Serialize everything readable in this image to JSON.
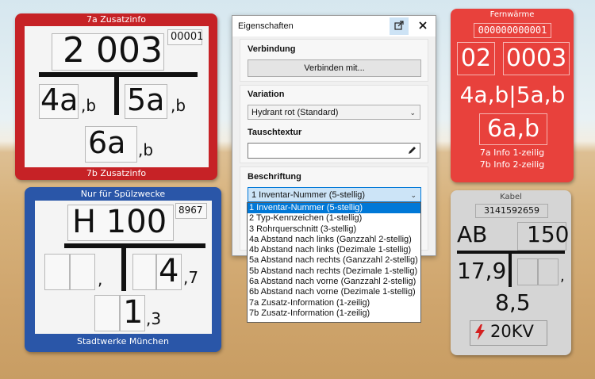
{
  "signs": {
    "red_top": {
      "top_label": "7a Zusatzinfo",
      "bottom_label": "7b Zusatzinfo",
      "number": "2 003",
      "inventory": "00001",
      "left": "4a",
      "left_suffix": ",b",
      "right": "5a",
      "right_suffix": ",b",
      "bottom": "6a",
      "bottom_suffix": ",b",
      "color": "#c62226"
    },
    "blue": {
      "top_label": "Nur für Spülzwecke",
      "bottom_label": "Stadtwerke München",
      "number": "H 100",
      "inventory": "8967",
      "left_suffix": ",",
      "right": "4",
      "right_suffix": ",7",
      "bottom": "1",
      "bottom_suffix": ",3",
      "color": "#2a56a8"
    },
    "red_right": {
      "top_label": "Fernwärme",
      "inventory": "000000000001",
      "number_left": "02",
      "number_right": "0003",
      "middle": "4a,b|5a,b",
      "bottom": "6a,b",
      "info1": "7a Info 1-zeilig",
      "info2": "7b Info 2-zeilig",
      "color": "#e8413c"
    },
    "grey": {
      "top_label": "Kabel",
      "inventory": "3141592659",
      "number_left": "AB",
      "number_right": "150",
      "left": "17,9",
      "right_suffix": ",",
      "bottom": "8,5",
      "voltage": "20KV",
      "color": "#d5d5d5",
      "bolt_color": "#d42020"
    }
  },
  "panel": {
    "title": "Eigenschaften",
    "popout_icon": "popout-icon",
    "close_icon": "close-icon",
    "connection": {
      "title": "Verbindung",
      "button": "Verbinden mit..."
    },
    "variation": {
      "title": "Variation",
      "value": "Hydrant rot (Standard)"
    },
    "texture": {
      "title": "Tauschtextur",
      "value": "",
      "edit_icon": "pencil-icon"
    },
    "label": {
      "title": "Beschriftung",
      "value": "1 Inventar-Nummer (5-stellig)"
    }
  },
  "dropdown": {
    "options": [
      "1 Inventar-Nummer (5-stellig)",
      "2 Typ-Kennzeichen (1-stellig)",
      "3 Rohrquerschnitt (3-stellig)",
      "4a Abstand nach links (Ganzzahl 2-stellig)",
      "4b Abstand nach links (Dezimale 1-stellig)",
      "5a Abstand nach rechts (Ganzzahl 2-stellig)",
      "5b Abstand nach rechts (Dezimale 1-stellig)",
      "6a Abstand nach vorne (Ganzzahl 2-stellig)",
      "6b Abstand nach vorne (Dezimale 1-stellig)",
      "7a Zusatz-Information (1-zeilig)",
      "7b Zusatz-Information (1-zeilig)"
    ],
    "selected_index": 0,
    "selected_color": "#0078d7"
  }
}
